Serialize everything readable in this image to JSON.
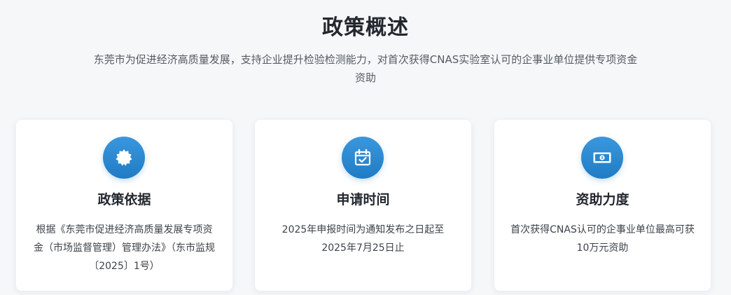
{
  "header": {
    "title": "政策概述",
    "subtitle": "东莞市为促进经济高质量发展，支持企业提升检验检测能力，对首次获得CNAS实验室认可的企事业单位提供专项资金资助"
  },
  "cards": [
    {
      "icon": "certificate-badge-icon",
      "title": "政策依据",
      "description": "根据《东莞市促进经济高质量发展专项资金（市场监督管理）管理办法》（东市监规〔2025〕1号）"
    },
    {
      "icon": "calendar-check-icon",
      "title": "申请时间",
      "description": "2025年申报时间为通知发布之日起至2025年7月25日止"
    },
    {
      "icon": "money-bill-icon",
      "title": "资助力度",
      "description": "首次获得CNAS认可的企事业单位最高可获10万元资助"
    }
  ],
  "colors": {
    "accent": "#2a88d0",
    "background": "#f6f7f9",
    "card": "#ffffff"
  }
}
